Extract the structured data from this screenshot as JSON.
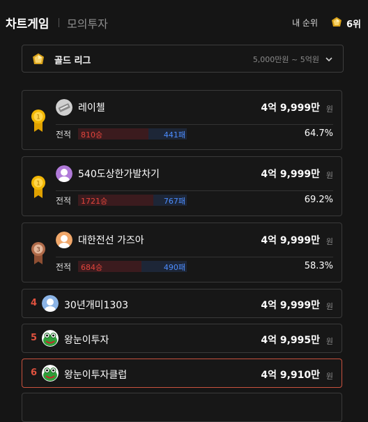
{
  "header": {
    "tab_chart_game": "차트게임",
    "tab_mock_invest": "모의투자",
    "my_rank_label": "내 순위",
    "my_rank_value": "6위",
    "my_rank_icon": "gold-gem-icon"
  },
  "league": {
    "icon": "gold-gem-icon",
    "name": "골드 리그",
    "range": "5,000만원 ~ 5억원",
    "chevron": "chevron-down-icon"
  },
  "colors": {
    "background": "#151515",
    "win": "#e4453c",
    "loss": "#4d8dff",
    "rank_number": "#e0523f",
    "highlight_border": "#c9523f",
    "gold": "#f2b705",
    "bronze": "#b06b4a"
  },
  "ranking": [
    {
      "medal": "gold-medal-icon",
      "medal_number": "1",
      "avatar": "device-avatar",
      "name": "레이첼",
      "amount": "4억 9,999만",
      "unit": "원",
      "record_label": "전적",
      "wins": "810승",
      "losses": "441패",
      "win_fraction": 0.647,
      "win_rate": "64.7%"
    },
    {
      "medal": "gold-medal-icon",
      "medal_number": "1",
      "avatar": "purple-person-avatar",
      "name": "540도상한가발차기",
      "amount": "4억 9,999만",
      "unit": "원",
      "record_label": "전적",
      "wins": "1721승",
      "losses": "767패",
      "win_fraction": 0.692,
      "win_rate": "69.2%"
    },
    {
      "medal": "bronze-medal-icon",
      "medal_number": "3",
      "avatar": "orange-person-avatar",
      "name": "대한전선 가즈아",
      "amount": "4억 9,999만",
      "unit": "원",
      "record_label": "전적",
      "wins": "684승",
      "losses": "490패",
      "win_fraction": 0.583,
      "win_rate": "58.3%"
    },
    {
      "rank": "4",
      "avatar": "blue-person-avatar",
      "name": "30년개미1303",
      "amount": "4억 9,999만",
      "unit": "원"
    },
    {
      "rank": "5",
      "avatar": "frog-avatar",
      "name": "왕눈이투자",
      "amount": "4억 9,995만",
      "unit": "원"
    },
    {
      "rank": "6",
      "avatar": "frog-avatar",
      "name": "왕눈이투자클럽",
      "amount": "4억 9,910만",
      "unit": "원",
      "is_me": true
    }
  ]
}
